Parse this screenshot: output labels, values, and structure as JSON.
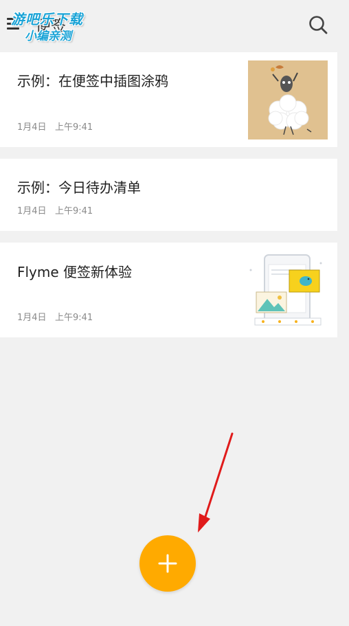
{
  "app": {
    "title": "便签"
  },
  "watermark": {
    "line1": "游吧乐下载",
    "line2": "小编亲测"
  },
  "notes": [
    {
      "title": "示例：在便签中插图涂鸦",
      "date": "1月4日",
      "time": "上午9:41",
      "thumbnail": "sheep-doodle-image"
    },
    {
      "title": "示例：今日待办清单",
      "date": "1月4日",
      "time": "上午9:41"
    },
    {
      "title": "Flyme 便签新体验",
      "date": "1月4日",
      "time": "上午9:41",
      "thumbnail": "phone-illustration-image"
    }
  ],
  "icons": {
    "menu": "menu-icon",
    "search": "search-icon",
    "add": "plus-icon"
  },
  "colors": {
    "background": "#f1f1f1",
    "fab": "#ffaa00",
    "arrow": "#e01b1b",
    "watermark": "#1aa3d6"
  }
}
